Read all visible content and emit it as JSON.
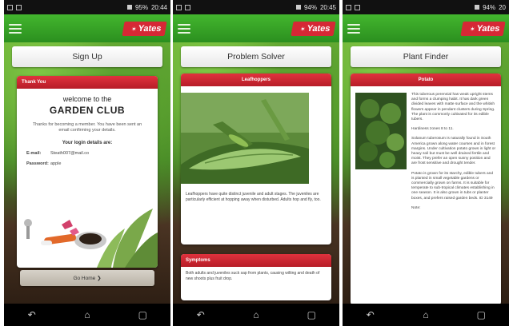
{
  "screens": [
    {
      "status": {
        "battery": "95%",
        "time": "20:44"
      },
      "brand": "Yates",
      "title": "Sign Up",
      "card": {
        "header": "Thank You",
        "welcome": "welcome to the",
        "club": "GARDEN CLUB",
        "thanks": "Thanks for becoming a member. You have been sent an email confirming your details.",
        "details_heading": "Your login details are:",
        "email_label": "E-mail:",
        "email_value": "Steath007@mail.co",
        "password_label": "Password:",
        "password_value": "apple"
      },
      "go_home_label": "Go Home ❯"
    },
    {
      "status": {
        "battery": "94%",
        "time": "20:45"
      },
      "brand": "Yates",
      "title": "Problem Solver",
      "card": {
        "header": "Leafhoppers",
        "description": "Leafhoppers have quite distinct juvenile and adult stages. The juveniles are particularly efficient at hopping away when disturbed. Adults hop and fly, too."
      },
      "symptoms": {
        "header": "Symptoms",
        "text": "Both adults and juveniles suck sap from plants, causing wilting and death of new shoots plus fruit drop."
      }
    },
    {
      "status": {
        "battery": "94%",
        "time": "20"
      },
      "brand": "Yates",
      "title": "Plant Finder",
      "card": {
        "header": "Potato",
        "para1": "This tuberous perennial has weak upright stems and forms a clumping habit. It has dark green divided leaves with matte surface and the whitish flowers appear in pendant clusters during Spring. The plant is commonly cultivated for its edible tubers.",
        "para2": "Hardiness zones 8 to 11.",
        "para3": "Solanum tuberosum is naturally found in South America grown along water courses and in forest margins. Under cultivation potato grows in light or heavy soil but must be well drained fertile and moist. They prefer an open sunny position and are frost sensitive and drought tender.",
        "para4": "Potato is grown for its starchy, edible tubers and is planted in small vegetable gardens or commercially grown on farms. It is suitable for temperate to sub-tropical climates establishing in one season. It is also grown in tubs or planter boxes, and prefers raised garden beds. ID 3149",
        "para5": "Note:"
      }
    }
  ],
  "nav": {
    "back": "↶",
    "home": "⌂",
    "recents": "▢"
  }
}
